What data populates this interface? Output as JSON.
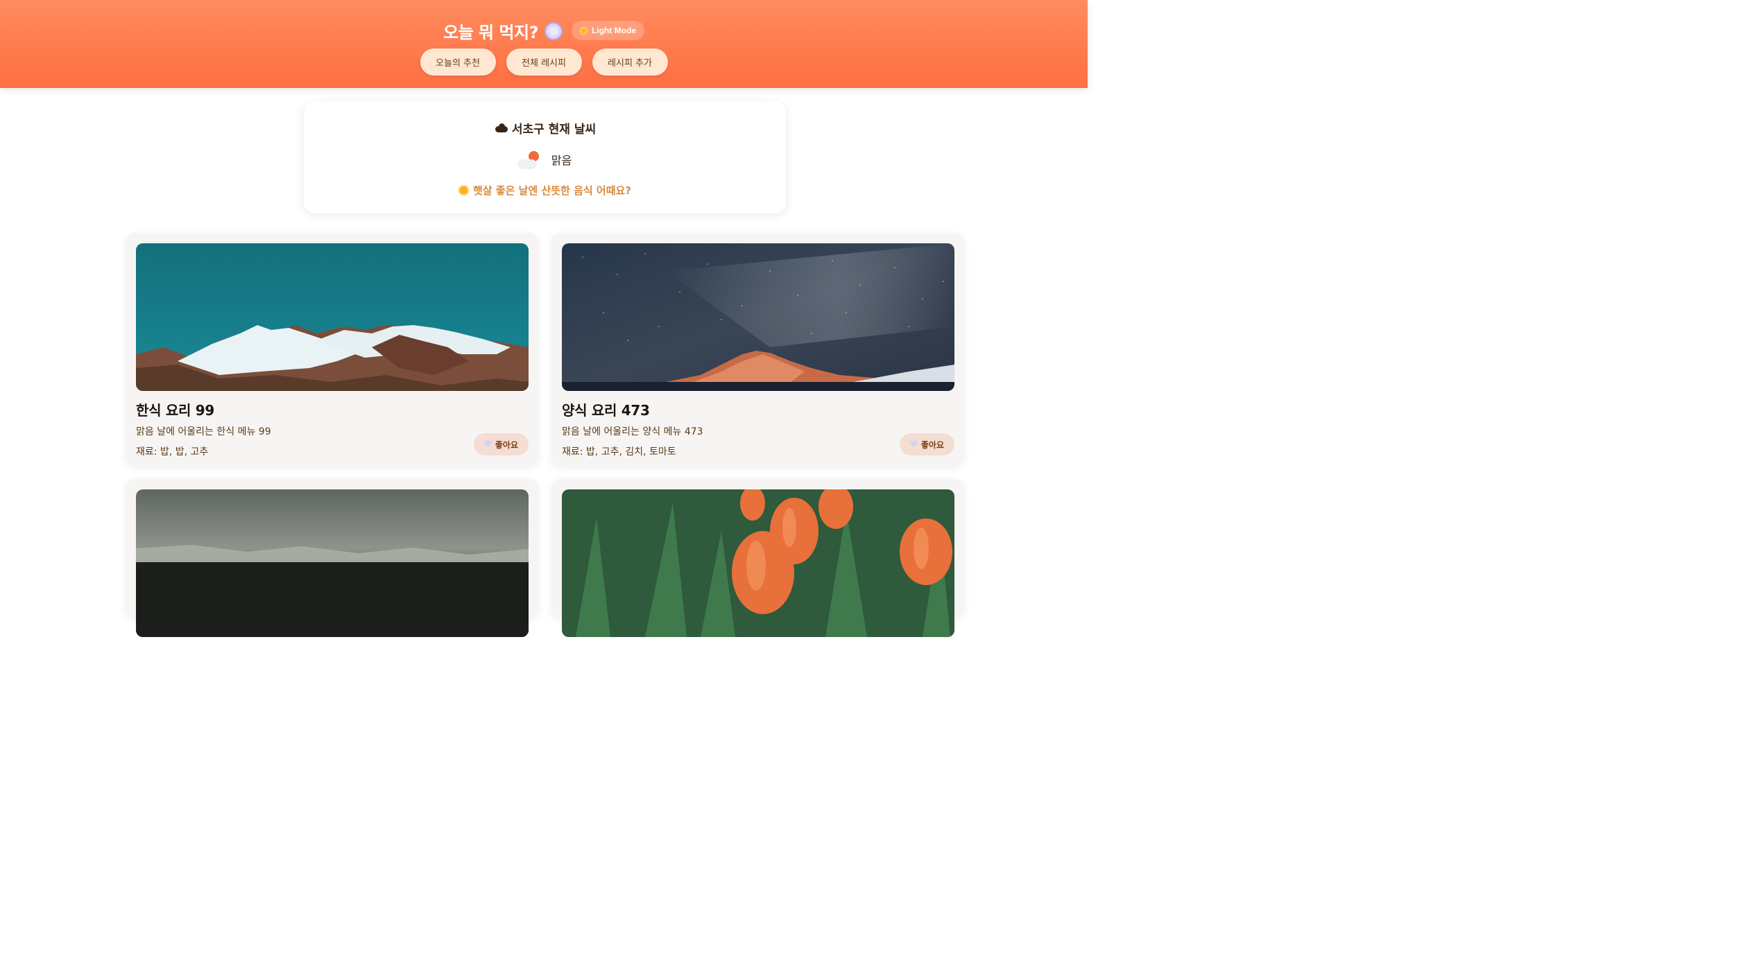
{
  "header": {
    "title": "오늘 뭐 먹지?",
    "title_icon": "plate-icon",
    "theme_toggle_label": "Light Mode",
    "nav": [
      {
        "label": "오늘의 추천"
      },
      {
        "label": "전체 레시피"
      },
      {
        "label": "레시피 추가"
      }
    ]
  },
  "weather": {
    "heading": "서초구 현재 날씨",
    "condition": "맑음",
    "tip": "햇살 좋은 날엔 산뜻한 음식 어때요?"
  },
  "recipes": [
    {
      "name": "한식 요리 99",
      "description": "맑음 날에 어울리는 한식 메뉴 99",
      "ingredients": "재료: 밥, 밥, 고추",
      "like_label": "좋아요",
      "image": "snowy-mountains"
    },
    {
      "name": "양식 요리 473",
      "description": "맑음 날에 어울리는 양식 메뉴 473",
      "ingredients": "재료: 밥, 고추, 김치, 토마토",
      "like_label": "좋아요",
      "image": "starry-night-mountain"
    },
    {
      "image": "frosty-field"
    },
    {
      "image": "orange-tulips"
    }
  ],
  "colors": {
    "header_gradient_start": "#ff8c5f",
    "header_gradient_end": "#ff6f43",
    "nav_button_bg": "#ffe7d2",
    "tip_text": "#d98a3a"
  }
}
